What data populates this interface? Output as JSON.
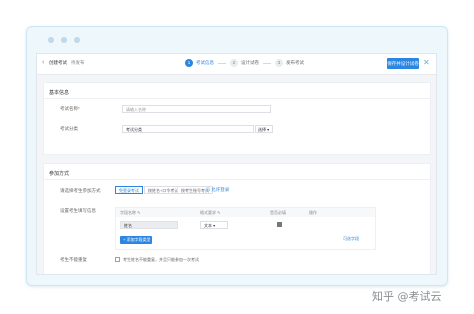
{
  "header": {
    "back_icon": "back-arrow-icon",
    "title": "创建考试",
    "status": "待发布",
    "steps": [
      {
        "num": "1",
        "label": "考试信息",
        "active": true
      },
      {
        "num": "2",
        "label": "设计试卷",
        "active": false
      },
      {
        "num": "3",
        "label": "发布考试",
        "active": false
      }
    ],
    "save_label": "保存并设计试卷",
    "close_icon": "close-icon"
  },
  "basic": {
    "title": "基本信息",
    "exam_name_label": "考试名称",
    "exam_name_required": "*",
    "exam_name_placeholder": "请输入名称",
    "category_label": "考试分类",
    "category_value": "考试分类",
    "category_select": "选择 ▾"
  },
  "participation": {
    "title": "参加方式",
    "method_label": "请选择考生参加方式",
    "options": [
      "免登录考试",
      "按姓名+口令考试",
      "按考生账号考试"
    ],
    "options_selected": 0,
    "options_link": "☐ 允许登录",
    "fields_label": "设置考生填写信息",
    "table_headers": [
      "字段名称 ✎",
      "格式要求 ✎",
      "是否必填",
      "操作"
    ],
    "row_name": "姓名",
    "row_format": "文本",
    "row_required": true,
    "row_edit_link": "可选字段",
    "add_button": "+ 添加字段类型",
    "unique_label": "考生不能重复",
    "unique_option": "考生姓名不能重复，并且只能参加一次考试",
    "unique_checked": false
  },
  "watermark": "知乎 @考试云",
  "colors": {
    "accent": "#2a86e0",
    "frame": "#eef7fb"
  }
}
